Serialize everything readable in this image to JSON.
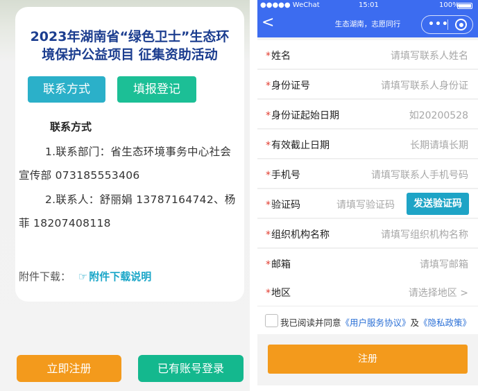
{
  "left": {
    "title": "2023年湖南省“绿色卫士”生态环\n境保护公益项目 征集资助活动",
    "tabs": {
      "contact": "联系方式",
      "register": "填报登记"
    },
    "contact_heading": "联系方式",
    "para1": "1.联系部门：省生态环境事务中心社会宣传部 073185553406",
    "para2": "2.联系人：舒丽娟 13787164742、杨菲 18207408118",
    "attachment_label": "附件下载：",
    "attachment_link": "附件下载说明",
    "signup_button": "立即注册",
    "login_button": "已有账号登录"
  },
  "right": {
    "status": {
      "carrier": "●●●●● WeChat",
      "time": "15:01",
      "battery": "100%"
    },
    "nav": {
      "back_glyph": "<",
      "title": "生态湖南，志愿同行",
      "more_glyph": "•••"
    },
    "form": [
      {
        "label": "姓名",
        "placeholder": "请填写联系人姓名"
      },
      {
        "label": "身份证号",
        "placeholder": "请填写联系人身份证"
      },
      {
        "label": "身份证起始日期",
        "placeholder": "如20200528"
      },
      {
        "label": "有效截止日期",
        "placeholder": "长期请填长期"
      },
      {
        "label": "手机号",
        "placeholder": "请填写联系人手机号码"
      },
      {
        "label": "验证码",
        "placeholder": "请填写验证码",
        "action": "发送验证码"
      },
      {
        "label": "组织机构名称",
        "placeholder": "请填写组织机构名称"
      },
      {
        "label": "邮箱",
        "placeholder": "请填写邮箱"
      },
      {
        "label": "地区",
        "placeholder": "请选择地区 >"
      }
    ],
    "required_mark": "*",
    "agreement": {
      "prefix": "我已阅读并同意",
      "terms": "《用户服务协议》",
      "and": "及",
      "privacy": "《隐私政策》"
    },
    "submit": "注册"
  },
  "colors": {
    "title_blue": "#1b3d8f",
    "teal": "#2bb0c9",
    "green": "#1cbf96",
    "orange": "#f39a1c",
    "nav_blue": "#3c6cf0",
    "required_red": "#e23b2e"
  },
  "icons": [
    "hand-point-icon",
    "back-icon",
    "more-dots-icon",
    "target-icon",
    "battery-icon",
    "checkbox-icon"
  ]
}
